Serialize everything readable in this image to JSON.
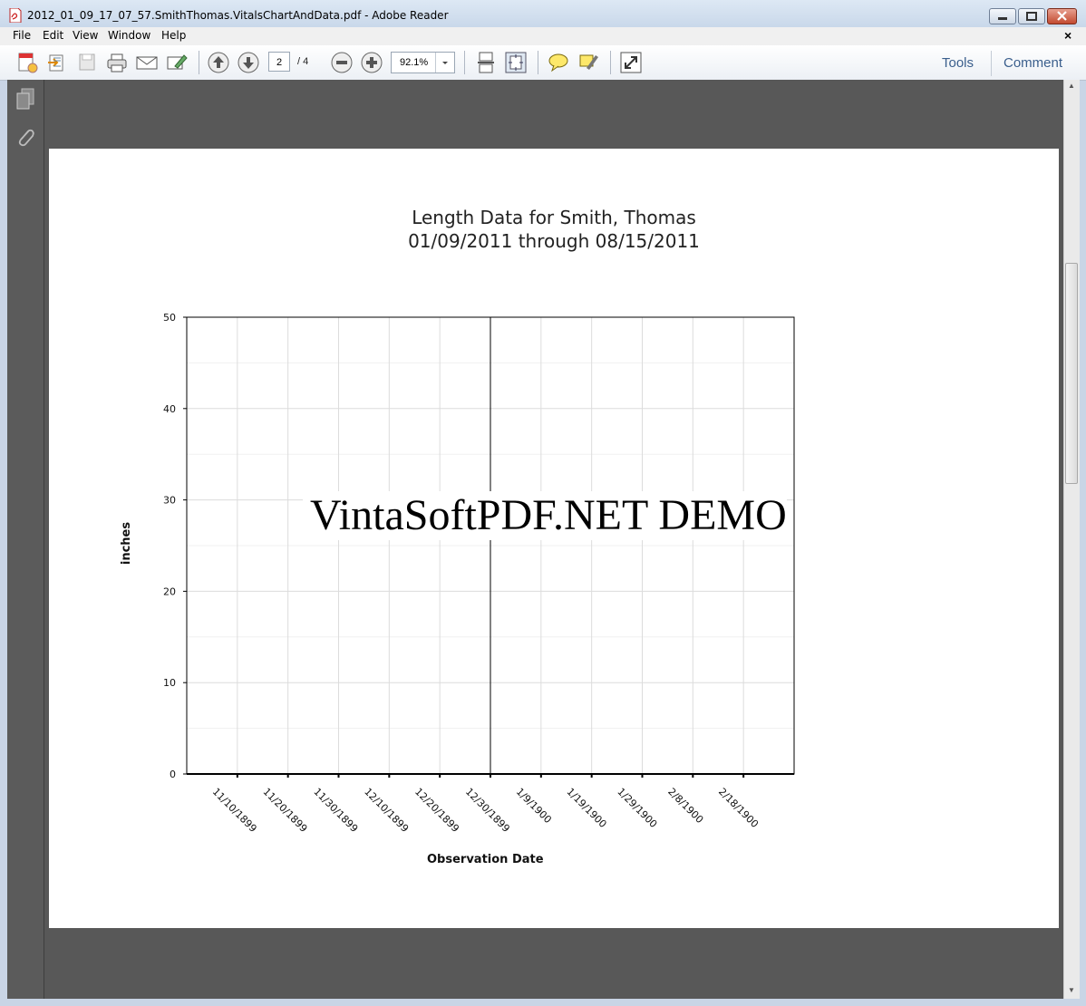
{
  "window": {
    "title": "2012_01_09_17_07_57.SmithThomas.VitalsChartAndData.pdf - Adobe Reader"
  },
  "menu": [
    "File",
    "Edit",
    "View",
    "Window",
    "Help"
  ],
  "toolbar": {
    "page_current": "2",
    "page_total": "/ 4",
    "zoom": "92.1%",
    "tools_label": "Tools",
    "comment_label": "Comment"
  },
  "watermark": "VintaSoftPDF.NET DEMO",
  "chart_data": {
    "type": "line",
    "title": "Length Data for Smith, Thomas",
    "subtitle": "01/09/2011 through 08/15/2011",
    "xlabel": "Observation Date",
    "ylabel": "inches",
    "ylim": [
      0,
      50
    ],
    "yticks": [
      0,
      10,
      20,
      30,
      40,
      50
    ],
    "xticks": [
      "11/10/1899",
      "11/20/1899",
      "11/30/1899",
      "12/10/1899",
      "12/20/1899",
      "12/30/1899",
      "1/9/1900",
      "1/19/1900",
      "1/29/1900",
      "2/8/1900",
      "2/18/1900"
    ],
    "marker_line_x": "12/30/1899",
    "series": [],
    "grid": true
  }
}
